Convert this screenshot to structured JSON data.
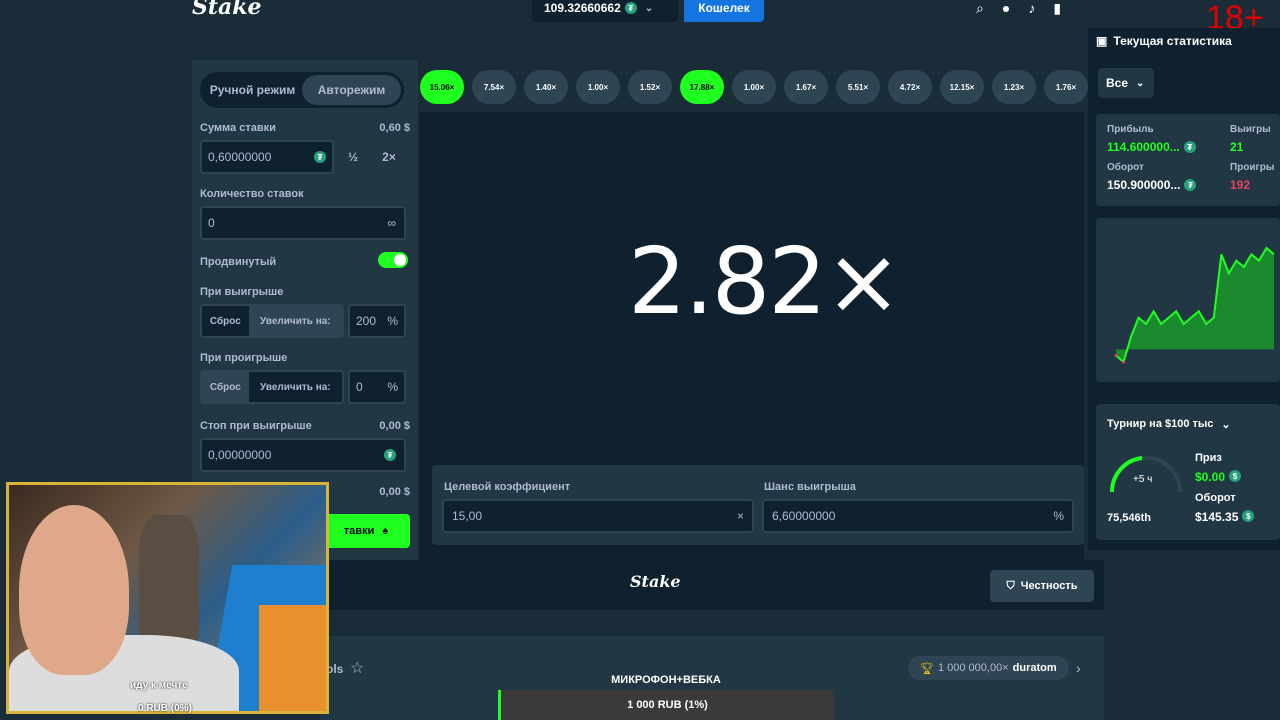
{
  "header": {
    "logo": "Stake",
    "balance": "109.32660662",
    "wallet_label": "Кошелек",
    "age_badge": "18+"
  },
  "controls": {
    "mode_manual": "Ручной режим",
    "mode_auto": "Авторежим",
    "bet_amount_label": "Сумма ставки",
    "bet_amount_usd": "0,60 $",
    "bet_amount_value": "0,60000000",
    "half": "½",
    "double": "2×",
    "bet_count_label": "Количество ставок",
    "bet_count_value": "0",
    "infinity": "∞",
    "advanced_label": "Продвинутый",
    "on_win_label": "При выигрыше",
    "reset": "Сброс",
    "increase_by": "Увеличить на:",
    "on_win_value": "200",
    "on_loss_label": "При проигрыше",
    "on_loss_value": "0",
    "percent": "%",
    "stop_on_win_label": "Стоп при выигрыше",
    "stop_on_win_usd": "0,00 $",
    "stop_on_win_value": "0,00000000",
    "stop_on_loss_usd": "0,00 $",
    "start_button": "тавки"
  },
  "history": [
    "15.06×",
    "7.54×",
    "1.40×",
    "1.00×",
    "1.52×",
    "17.88×",
    "1.00×",
    "1.67×",
    "5.51×",
    "4.72×",
    "12.15×",
    "1.23×",
    "1.76×"
  ],
  "game": {
    "multiplier": "2.82×",
    "target_label": "Целевой коэффициент",
    "target_value": "15,00",
    "chance_label": "Шанс выигрыша",
    "chance_value": "6,60000000",
    "clear": "×",
    "pct": "%"
  },
  "footer": {
    "logo": "Stake",
    "fairness": "Честность",
    "ols": "ols",
    "top_win": "1 000 000,00×",
    "top_user": "duratom"
  },
  "stats": {
    "title": "Текущая статистика",
    "filter": "Все",
    "profit_label": "Прибыль",
    "profit_value": "114.600000...",
    "wins_label": "Выигры",
    "wins_value": "21",
    "wagered_label": "Оборот",
    "wagered_value": "150.900000...",
    "losses_label": "Проигры",
    "losses_value": "192",
    "chart_data": {
      "type": "area",
      "title": "",
      "xlabel": "",
      "ylabel": "",
      "x": [
        0,
        1,
        2,
        3,
        4,
        5,
        6,
        7,
        8,
        9,
        10,
        11,
        12,
        13,
        14,
        15,
        16,
        17,
        18,
        19,
        20,
        21
      ],
      "values": [
        -1,
        -2,
        2,
        5,
        4,
        6,
        4,
        5,
        6,
        4,
        5,
        6,
        4,
        5,
        15,
        12,
        14,
        13,
        15,
        14,
        16,
        15
      ],
      "grid": false
    }
  },
  "tournament": {
    "title": "Турнир на $100 тыс",
    "timer": "+5 ч",
    "rank": "75,546th",
    "prize_label": "Приз",
    "prize_value": "$0.00",
    "wagered_label": "Оборот",
    "wagered_value": "$145.35"
  },
  "stream": {
    "caption": "иду к мечте",
    "rub_status": "0 RUB (0%)",
    "mic_label": "МИКРОФОН+ВЕБКА",
    "donation": "1 000 RUB (1%)"
  },
  "colors": {
    "bg": "#1a2c38",
    "panel": "#213743",
    "dark": "#0f212e",
    "green": "#1fff20",
    "blue": "#1475e1",
    "red": "#e00000"
  }
}
